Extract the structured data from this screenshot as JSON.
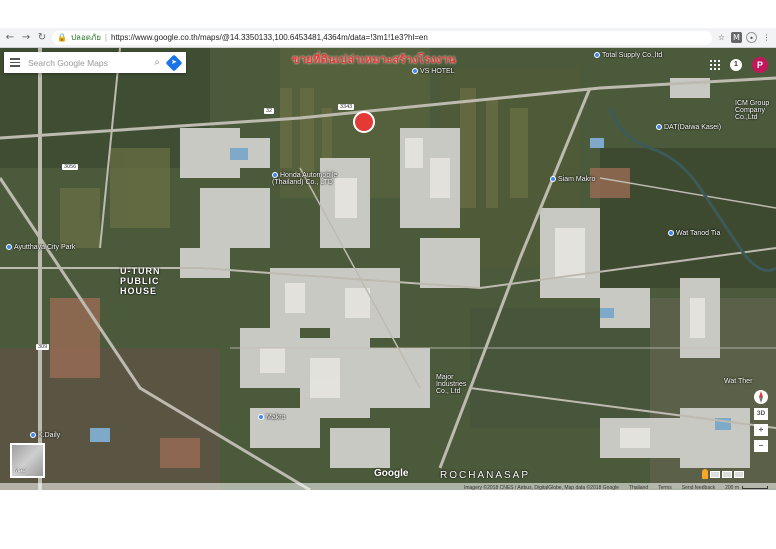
{
  "browser": {
    "back_icon": "arrow-left-icon",
    "forward_icon": "arrow-right-icon",
    "reload_icon": "reload-icon",
    "site_label": "ปลอดภัย",
    "url": "https://www.google.co.th/maps/@14.3350133,100.6453481,4364m/data=!3m1!1e3?hl=en"
  },
  "map": {
    "search_placeholder": "Search Google Maps",
    "heading_thai": "ขายที่ดินเปล่าเหมาะสร้างโรงงาน",
    "notification_count": "1",
    "avatar_letter": "P",
    "labels": {
      "total_supply": "Total Supply Co.,ltd",
      "vs_hotel": "VS HOTEL",
      "honda": "Honda Automobile (Thailand) Co., LTD",
      "siam_makro": "Siam Makro",
      "dat": "DAT(Daiwa Kasei)",
      "icm": "ICM Group Company Co.,Ltd",
      "wat_tanod": "Wat Tanod Tia",
      "wat_ther": "Wat Ther",
      "public_house": "U-TURN PUBLIC HOUSE",
      "makro": "Makro",
      "major_industries": "Major Industries Co., Ltd",
      "rochanasap": "ROCHANASAP",
      "ayutthaya": "Ayutthaya City Park",
      "kd": "K.Daily"
    },
    "road_shields": [
      "3343",
      "32",
      "3056",
      "309"
    ],
    "minimap_label": "Map",
    "google_logo": "Google",
    "controls": {
      "three_d": "3D",
      "zoom_in": "+",
      "zoom_out": "−"
    },
    "attribution": {
      "imagery": "Imagery ©2018 CNES / Airbus, DigitalGlobe, Map data ©2018 Google",
      "region": "Thailand",
      "terms": "Terms",
      "feedback": "Send feedback",
      "scale": "200 m"
    }
  }
}
